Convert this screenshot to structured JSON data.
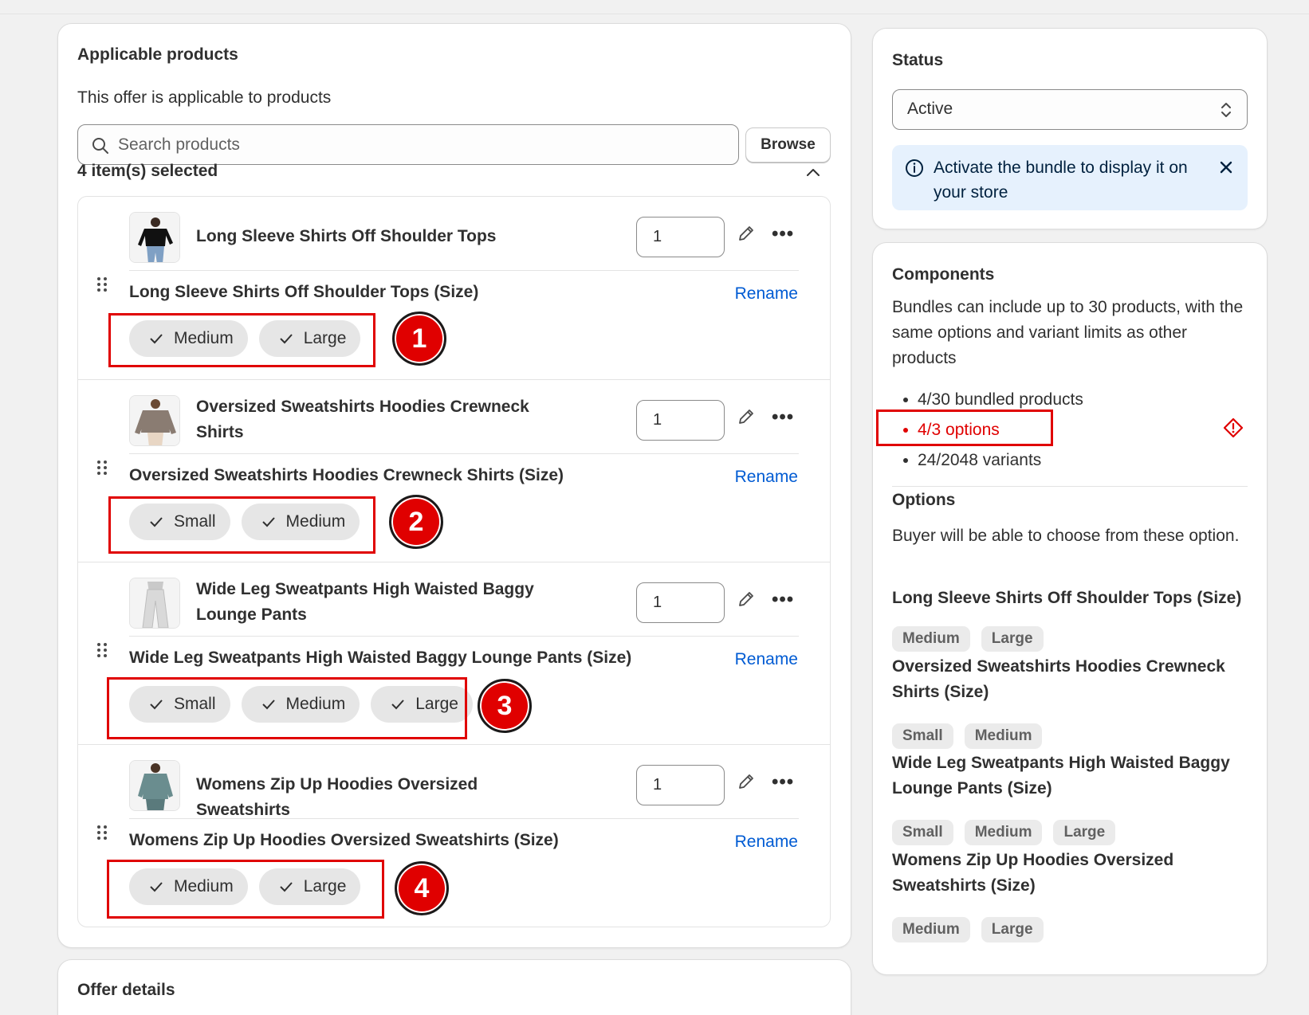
{
  "products_card": {
    "title": "Applicable products",
    "subtitle": "This offer is applicable to products",
    "search_placeholder": "Search products",
    "browse_label": "Browse",
    "selected_count": "4 item(s) selected",
    "items": [
      {
        "name": "Long Sleeve Shirts Off Shoulder Tops",
        "qty": "1",
        "option_title": "Long Sleeve Shirts Off Shoulder Tops (Size)",
        "rename": "Rename",
        "values": [
          "Medium",
          "Large"
        ],
        "marker": "1"
      },
      {
        "name": "Oversized Sweatshirts Hoodies Crewneck Shirts",
        "qty": "1",
        "option_title": "Oversized Sweatshirts Hoodies Crewneck Shirts (Size)",
        "rename": "Rename",
        "values": [
          "Small",
          "Medium"
        ],
        "marker": "2"
      },
      {
        "name": "Wide Leg Sweatpants High Waisted Baggy Lounge Pants",
        "qty": "1",
        "option_title": "Wide Leg Sweatpants High Waisted Baggy Lounge Pants (Size)",
        "rename": "Rename",
        "values": [
          "Small",
          "Medium",
          "Large"
        ],
        "marker": "3"
      },
      {
        "name": "Womens Zip Up Hoodies Oversized Sweatshirts",
        "qty": "1",
        "option_title": "Womens Zip Up Hoodies Oversized Sweatshirts (Size)",
        "rename": "Rename",
        "values": [
          "Medium",
          "Large"
        ],
        "marker": "4"
      }
    ]
  },
  "offer_card": {
    "title": "Offer details"
  },
  "status_card": {
    "title": "Status",
    "selected": "Active",
    "banner_text": "Activate the bundle to display it on your store"
  },
  "components_card": {
    "title": "Components",
    "description": "Bundles can include up to 30 products, with the same options and variant limits as other products",
    "limits": [
      "4/30 bundled products",
      "4/3 options",
      "24/2048 variants"
    ],
    "options_title": "Options",
    "options_description": "Buyer will be able to choose from these option.",
    "options": [
      {
        "title": "Long Sleeve Shirts Off Shoulder Tops (Size)",
        "values": [
          "Medium",
          "Large"
        ]
      },
      {
        "title": "Oversized Sweatshirts Hoodies Crewneck Shirts (Size)",
        "values": [
          "Small",
          "Medium"
        ]
      },
      {
        "title": "Wide Leg Sweatpants High Waisted Baggy Lounge Pants (Size)",
        "values": [
          "Small",
          "Medium",
          "Large"
        ]
      },
      {
        "title": "Womens Zip Up Hoodies Oversized Sweatshirts (Size)",
        "values": [
          "Medium",
          "Large"
        ]
      }
    ]
  },
  "colors": {
    "accent_link": "#005bd3",
    "error": "#e00000",
    "info_banner": "#e6f1fd"
  },
  "icons": [
    "search-icon",
    "chevron-up-icon",
    "pencil-icon",
    "more-icon",
    "drag-handle-icon",
    "check-icon",
    "select-arrows-icon",
    "info-icon",
    "close-icon",
    "alert-diamond-icon"
  ]
}
